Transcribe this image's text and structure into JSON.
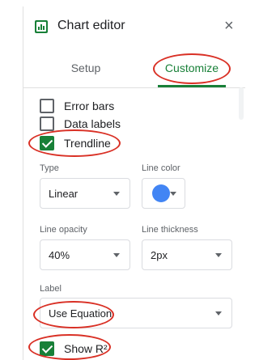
{
  "header": {
    "title": "Chart editor",
    "close_glyph": "×"
  },
  "tabs": [
    {
      "label": "Setup",
      "active": false
    },
    {
      "label": "Customize",
      "active": true
    }
  ],
  "checkboxes": {
    "error_bars": {
      "label": "Error bars",
      "checked": false
    },
    "data_labels": {
      "label": "Data labels",
      "checked": false
    },
    "trendline": {
      "label": "Trendline",
      "checked": true
    },
    "show_r2": {
      "label": "Show R²",
      "checked": true
    }
  },
  "fields": {
    "type": {
      "label": "Type",
      "value": "Linear"
    },
    "line_color": {
      "label": "Line color",
      "color": "#4285f4"
    },
    "line_opacity": {
      "label": "Line opacity",
      "value": "40%"
    },
    "line_thickness": {
      "label": "Line thickness",
      "value": "2px"
    },
    "label": {
      "label": "Label",
      "value": "Use Equation"
    }
  },
  "colors": {
    "accent": "#188038",
    "annotation": "#d93025"
  },
  "icons": {
    "chart": "chart-editor-icon",
    "close": "close-icon"
  }
}
